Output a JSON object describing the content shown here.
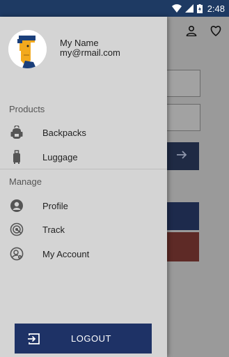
{
  "status_bar": {
    "time": "2:48"
  },
  "user": {
    "name": "My Name",
    "email": "my@rmail.com"
  },
  "sections": {
    "products": {
      "header": "Products",
      "items": [
        {
          "label": "Backpacks",
          "icon": "backpack-icon"
        },
        {
          "label": "Luggage",
          "icon": "luggage-icon"
        }
      ]
    },
    "manage": {
      "header": "Manage",
      "items": [
        {
          "label": "Profile",
          "icon": "account-circle-icon"
        },
        {
          "label": "Track",
          "icon": "track-radar-icon"
        },
        {
          "label": "My Account",
          "icon": "manage-account-icon"
        }
      ]
    }
  },
  "logout": {
    "label": "LOGOUT",
    "icon": "exit-icon"
  },
  "colors": {
    "primary": "#1e3266",
    "status_bar": "#1e3a63",
    "drawer_bg": "#d4d4d4",
    "avatar_accent": "#f2a91e"
  }
}
